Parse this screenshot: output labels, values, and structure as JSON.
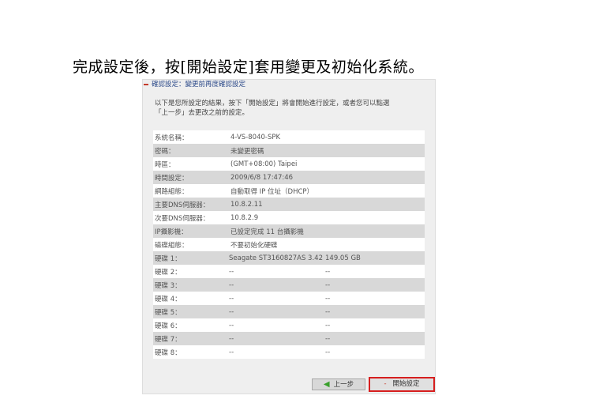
{
  "instruction": "完成設定後，按[開始設定]套用變更及初始化系統。",
  "panel": {
    "title": "確認設定：變更前再度確認設定",
    "intro_line1": "以下是您所設定的結果，按下「開始設定」將會開始進行設定，或者您可以點選",
    "intro_line2": "「上一步」去更改之前的設定。"
  },
  "rows": [
    {
      "label": "系統名稱：",
      "value": "4-VS-8040-SPK"
    },
    {
      "label": "密碼：",
      "value": "未變更密碼"
    },
    {
      "label": "時區：",
      "value": "(GMT+08:00) Taipei"
    },
    {
      "label": "時間設定：",
      "value": "2009/6/8 17:47:46"
    },
    {
      "label": "網路組態：",
      "value": "自動取得 IP 位址（DHCP）"
    },
    {
      "label": "主要DNS伺服器：",
      "value": "10.8.2.11"
    },
    {
      "label": "次要DNS伺服器：",
      "value": "10.8.2.9"
    },
    {
      "label": "IP攝影機：",
      "value": "已設定完成 11 台攝影機"
    },
    {
      "label": "磁碟組態：",
      "value": "不要初始化硬碟"
    }
  ],
  "disks": [
    {
      "label": "硬碟 1：",
      "model": "Seagate ST3160827AS 3.42",
      "size": "149.05 GB"
    },
    {
      "label": "硬碟 2：",
      "model": "--",
      "size": "--"
    },
    {
      "label": "硬碟 3：",
      "model": "--",
      "size": "--"
    },
    {
      "label": "硬碟 4：",
      "model": "--",
      "size": "--"
    },
    {
      "label": "硬碟 5：",
      "model": "--",
      "size": "--"
    },
    {
      "label": "硬碟 6：",
      "model": "--",
      "size": "--"
    },
    {
      "label": "硬碟 7：",
      "model": "--",
      "size": "--"
    },
    {
      "label": "硬碟 8：",
      "model": "--",
      "size": "--"
    }
  ],
  "buttons": {
    "prev_label": "上一步",
    "apply_label": "開始設定"
  },
  "colors": {
    "header_text": "#2c4a8a",
    "highlight_border": "#d61f1f",
    "prev_arrow": "#3aa02c"
  }
}
